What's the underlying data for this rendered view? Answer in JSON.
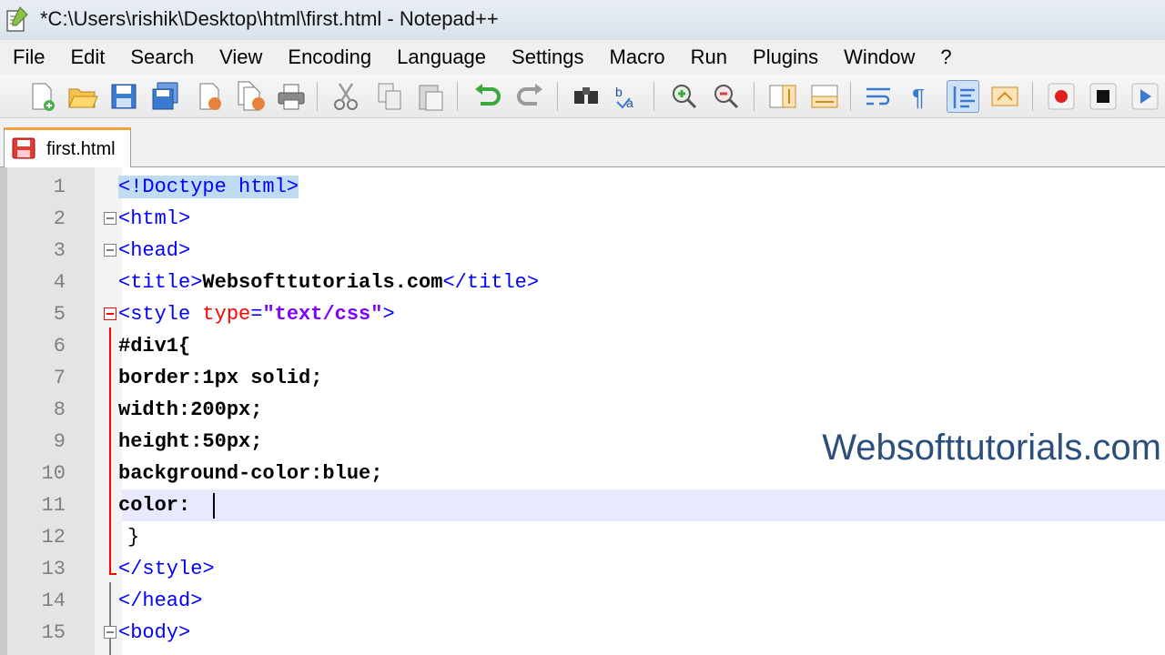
{
  "window": {
    "title": "*C:\\Users\\rishik\\Desktop\\html\\first.html - Notepad++"
  },
  "menu": [
    "File",
    "Edit",
    "Search",
    "View",
    "Encoding",
    "Language",
    "Settings",
    "Macro",
    "Run",
    "Plugins",
    "Window",
    "?"
  ],
  "toolbar": {
    "buttons": [
      "new-file",
      "open-file",
      "save",
      "save-all",
      "close",
      "close-all",
      "print",
      "cut",
      "copy",
      "paste",
      "undo",
      "redo",
      "find",
      "replace",
      "zoom-in",
      "zoom-out",
      "sync-vertical",
      "sync-horizontal",
      "word-wrap",
      "show-all-characters",
      "indent-guide",
      "user-language",
      "record-macro",
      "stop-recording",
      "play-macro"
    ]
  },
  "tab": {
    "label": "first.html",
    "modified": true
  },
  "editor": {
    "line_numbers": [
      "1",
      "2",
      "3",
      "4",
      "5",
      "6",
      "7",
      "8",
      "9",
      "10",
      "11",
      "12",
      "13",
      "14",
      "15"
    ],
    "lines": {
      "l1": "<!Doctype html>",
      "l2": "<html>",
      "l3": "<head>",
      "l4_open": "<title>",
      "l4_text": "Websofttutorials.com",
      "l4_close": "</title>",
      "l5_open": "<style ",
      "l5_attr": "type",
      "l5_eq": "=",
      "l5_val": "\"text/css\"",
      "l5_close": ">",
      "l6": "#div1{",
      "l7": "border:1px solid;",
      "l8": "width:200px;",
      "l9": "height:50px;",
      "l10": "background-color:blue;",
      "l11": "color:",
      "l12": "}",
      "l13": "</style>",
      "l14": "</head>",
      "l15": "<body>"
    },
    "current_line": 11
  },
  "watermark": "Websofttutorials.com",
  "colors": {
    "tag": "#0000ff",
    "attribute": "#ff0000",
    "string": "#8000ff",
    "current_line_bg": "#e8e8ff",
    "tab_accent": "#f0a040"
  }
}
